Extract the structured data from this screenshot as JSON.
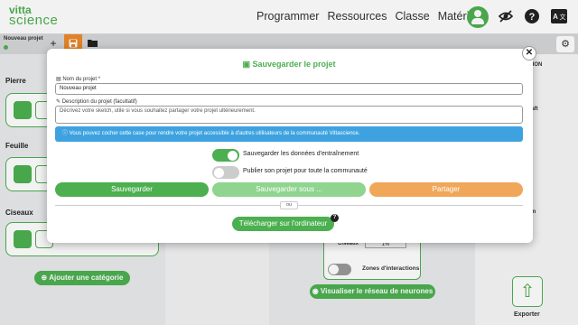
{
  "logo": {
    "line1": "vitta",
    "line2": "science"
  },
  "nav": {
    "items": [
      "Programmer",
      "Ressources",
      "Classe",
      "Matériel"
    ]
  },
  "project": {
    "name": "Nouveau projet"
  },
  "background": {
    "categories": [
      "Pierre",
      "Feuille",
      "Ciseaux"
    ],
    "add_category_label": "Ajouter une catégorie",
    "net_category_label": "Ciseaux",
    "net_percent": "1%",
    "zones_label": "Zones d'interactions",
    "visualize_label": "Visualiser le réseau de neurones",
    "right_partial_1": "TION",
    "right_partial_2": "raft",
    "right_partial_3": "on",
    "export_label": "Exporter"
  },
  "modal": {
    "title": "Sauvegarder le projet",
    "name_label": "Nom du projet *",
    "name_value": "Nouveau projet",
    "desc_label": "Description du projet (facultatif)",
    "desc_placeholder": "Décrivez votre sketch, utile si vous souhaitez partager votre projet ultérieurement.",
    "info_text": "Vous pouvez cocher cette case pour rendre votre projet accessible à d'autres utilisateurs de la communauté Vittascience.",
    "toggle_training": {
      "label": "Sauvegarder les données d'entraînement",
      "on": true
    },
    "toggle_publish": {
      "label": "Publier son projet pour toute la communauté",
      "on": false
    },
    "save_label": "Sauvegarder",
    "save_as_label": "Sauvegarder sous ...",
    "share_label": "Partager",
    "or_label": "ou",
    "download_label": "Télécharger sur l'ordinateur",
    "help_label": "?"
  },
  "colors": {
    "green": "#4caf50",
    "orange": "#ef8a2b",
    "info_blue": "#3fa2e0",
    "light_green": "#8fd48f",
    "share_orange": "#f0a75a"
  }
}
